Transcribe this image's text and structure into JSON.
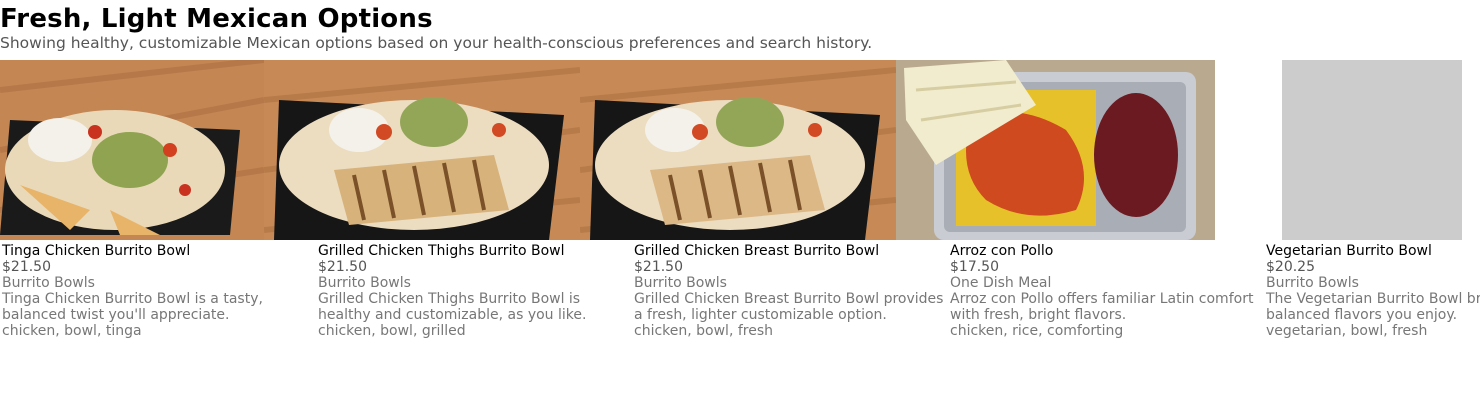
{
  "header": {
    "title": "Fresh, Light Mexican Options",
    "subtitle": "Showing healthy, customizable Mexican options based on your health-conscious preferences and search history."
  },
  "items": [
    {
      "name": "Tinga Chicken Burrito Bowl",
      "price": "$21.50",
      "category": "Burrito Bowls",
      "description": "Tinga Chicken Burrito Bowl is a tasty, balanced twist you'll appreciate.",
      "tags": "chicken, bowl, tinga",
      "image": "tinga-bowl-photo"
    },
    {
      "name": "Grilled Chicken Thighs Burrito Bowl",
      "price": "$21.50",
      "category": "Burrito Bowls",
      "description": "Grilled Chicken Thighs Burrito Bowl is healthy and customizable, as you like.",
      "tags": "chicken, bowl, grilled",
      "image": "grilled-thigh-bowl-photo"
    },
    {
      "name": "Grilled Chicken Breast Burrito Bowl",
      "price": "$21.50",
      "category": "Burrito Bowls",
      "description": "Grilled Chicken Breast Burrito Bowl provides a fresh, lighter customizable option.",
      "tags": "chicken, bowl, fresh",
      "image": "grilled-breast-bowl-photo"
    },
    {
      "name": "Arroz con Pollo",
      "price": "$17.50",
      "category": "One Dish Meal",
      "description": "Arroz con Pollo offers familiar Latin comfort with fresh, bright flavors.",
      "tags": "chicken, rice, comforting",
      "image": "arroz-con-pollo-photo"
    },
    {
      "name": "Vegetarian Burrito  Bowl",
      "price": "$20.25",
      "category": "Burrito Bowls",
      "description": "The Vegetarian Burrito Bowl brings fresh, balanced flavors you enjoy.",
      "tags": "vegetarian, bowl, fresh",
      "image": "image-placeholder"
    }
  ],
  "colors": {
    "title": "#000000",
    "subtitle": "#555555",
    "muted": "#777777",
    "placeholder": "#cccccc"
  }
}
